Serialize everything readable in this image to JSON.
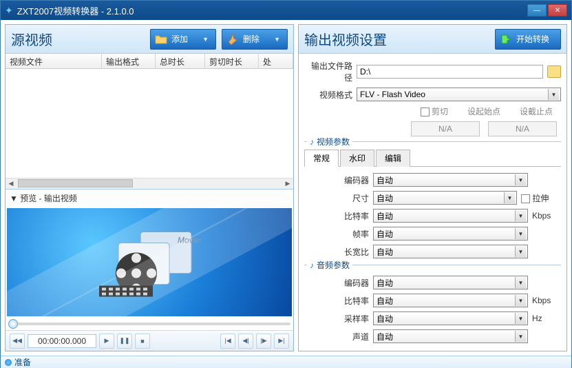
{
  "window": {
    "title": "ZXT2007视频转换器 - 2.1.0.0"
  },
  "left": {
    "title": "源视频",
    "add_label": "添加",
    "del_label": "删除",
    "columns": [
      "视频文件",
      "输出格式",
      "总时长",
      "剪切时长",
      "处"
    ],
    "preview_title": "▼ 预览 - 输出视频",
    "time": "00:00:00.000"
  },
  "right": {
    "title": "输出视频设置",
    "start_label": "开始转换",
    "output_path_label": "输出文件路径",
    "output_path_value": "D:\\",
    "format_label": "视频格式",
    "format_value": "FLV - Flash Video",
    "cut_label": "剪切",
    "start_point_label": "设起始点",
    "end_point_label": "设截止点",
    "na": "N/A",
    "video_params_title": "视频参数",
    "tabs": [
      "常规",
      "水印",
      "编辑"
    ],
    "encoder_label": "编码器",
    "size_label": "尺寸",
    "bitrate_label": "比特率",
    "fps_label": "帧率",
    "aspect_label": "长宽比",
    "stretch_label": "拉伸",
    "auto": "自动",
    "kbps": "Kbps",
    "hz": "Hz",
    "audio_params_title": "音频参数",
    "a_encoder_label": "编码器",
    "a_bitrate_label": "比特率",
    "a_sample_label": "采样率",
    "a_channel_label": "声道"
  },
  "status": {
    "text": "准备"
  }
}
